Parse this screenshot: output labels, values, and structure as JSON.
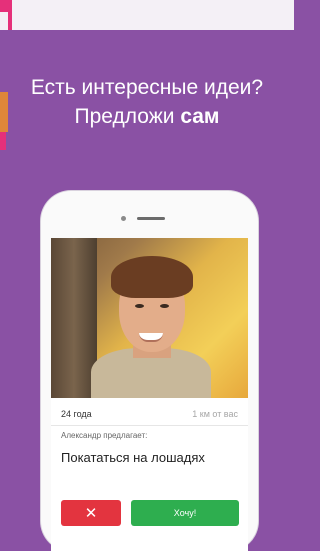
{
  "headline": {
    "line1": "Есть интересные идеи?",
    "line2_prefix": "Предложи ",
    "line2_bold": "сам"
  },
  "card": {
    "age": "24 года",
    "distance": "1 км от вас",
    "proposer": "Александр предлагает:",
    "idea": "Покататься на лошадях",
    "decline_icon": "✕",
    "accept_label": "Хочу!"
  },
  "colors": {
    "background": "#8a51a4",
    "decline": "#e3343f",
    "accept": "#2eae4f"
  }
}
